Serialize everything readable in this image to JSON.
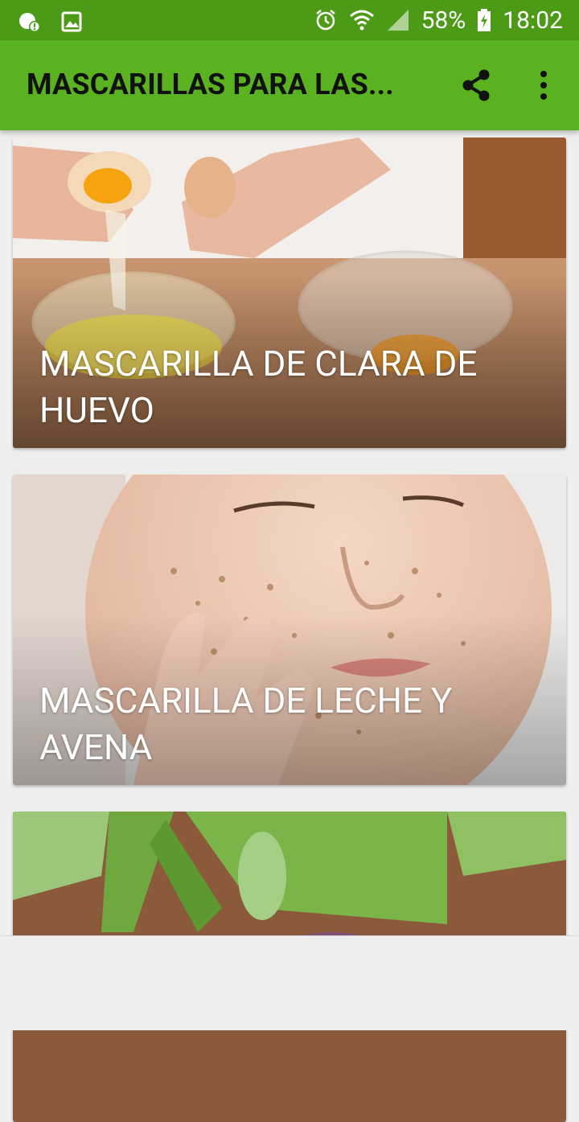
{
  "status_bar": {
    "battery_percent": "58%",
    "time": "18:02"
  },
  "app_bar": {
    "title": "MASCARILLAS PARA LAS..."
  },
  "cards": [
    {
      "title": "MASCARILLA DE CLARA DE HUEVO"
    },
    {
      "title": "MASCARILLA DE LECHE Y AVENA"
    },
    {
      "title": ""
    }
  ],
  "colors": {
    "status_bar": "#4c9a16",
    "app_bar": "#5ab220",
    "background": "#eeeeee"
  }
}
